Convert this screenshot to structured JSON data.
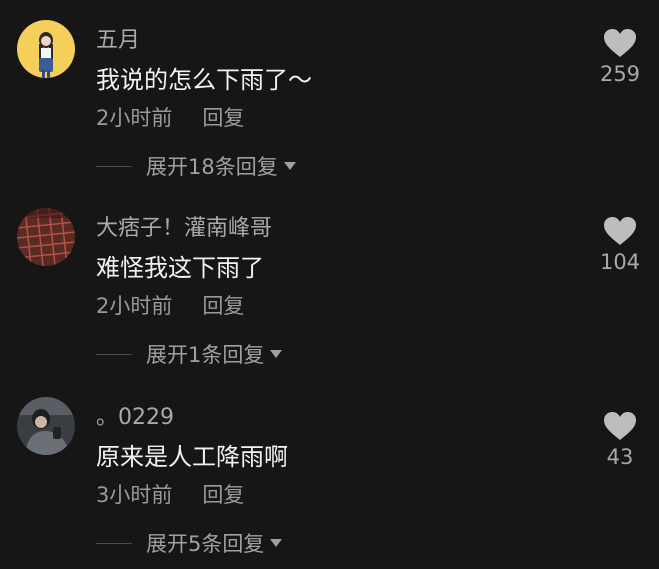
{
  "comments": [
    {
      "username": "五月",
      "content": "我说的怎么下雨了～",
      "time": "2小时前",
      "reply_label": "回复",
      "likes": "259",
      "expand_label": "展开18条回复",
      "avatar": "avatar-girl-yellow"
    },
    {
      "username": "大痞子！灌南峰哥",
      "content": "难怪我这下雨了",
      "time": "2小时前",
      "reply_label": "回复",
      "likes": "104",
      "expand_label": "展开1条回复",
      "avatar": "avatar-red-grid"
    },
    {
      "username": "。0229",
      "content": "原来是人工降雨啊",
      "time": "3小时前",
      "reply_label": "回复",
      "likes": "43",
      "expand_label": "展开5条回复",
      "avatar": "avatar-person-gray"
    }
  ],
  "colors": {
    "background": "#161616",
    "text_primary": "#f2f2f2",
    "text_secondary": "#9a9a9a",
    "heart": "#bdbdbd"
  }
}
